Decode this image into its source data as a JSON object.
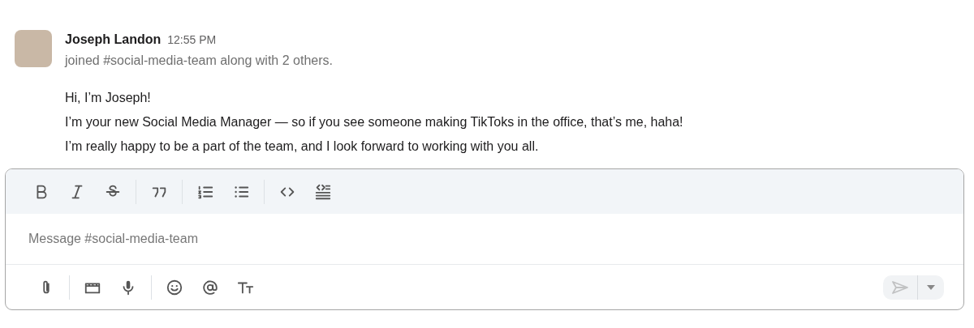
{
  "message": {
    "author": "Joseph Landon",
    "time": "12:55 PM",
    "system_text": "joined #social-media-team along with 2 others.",
    "lines": [
      "Hi, I’m Joseph!",
      "I’m your new Social Media Manager — so if you see someone making TikToks in the office, that’s me, haha!",
      "I’m really happy to be a part of the team, and I look forward to working with you all."
    ]
  },
  "composer": {
    "placeholder": "Message #social-media-team",
    "format_toolbar": [
      [
        {
          "kind": "bold"
        },
        {
          "kind": "italic"
        },
        {
          "kind": "strike"
        }
      ],
      [
        {
          "kind": "quote"
        }
      ],
      [
        {
          "kind": "ordered"
        },
        {
          "kind": "bullets"
        }
      ],
      [
        {
          "kind": "code"
        },
        {
          "kind": "codeblock"
        }
      ]
    ],
    "action_toolbar": [
      [
        {
          "kind": "attach"
        }
      ],
      [
        {
          "kind": "video"
        },
        {
          "kind": "mic"
        }
      ],
      [
        {
          "kind": "emoji"
        },
        {
          "kind": "mention"
        },
        {
          "kind": "textsize"
        }
      ]
    ],
    "send": {
      "disabled": true
    }
  }
}
